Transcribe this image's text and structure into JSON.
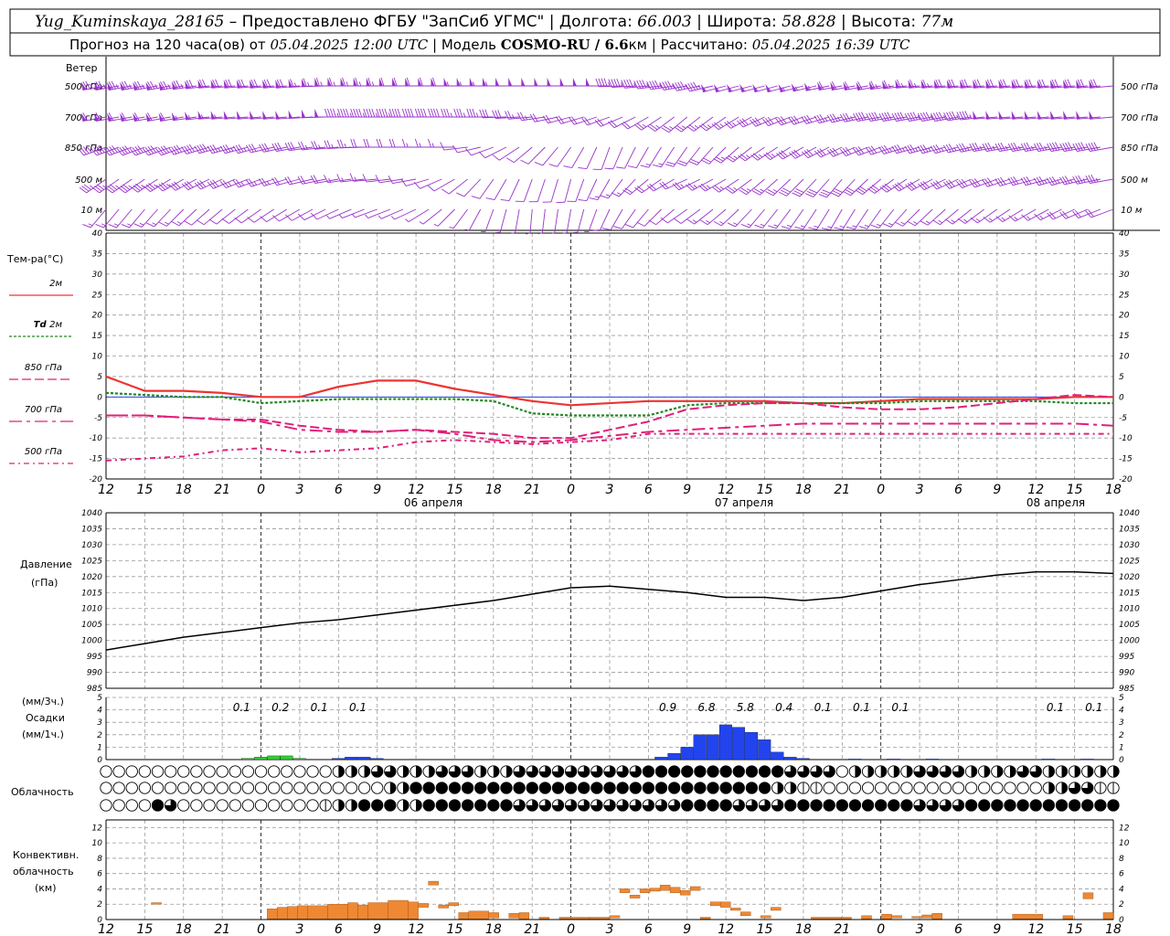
{
  "header": {
    "station": "Yug_Kuminskaya_28165",
    "dash": " – ",
    "provided": "Предоставлено ФГБУ \"ЗапСиб УГМС\"",
    "lon_label": "Долгота:",
    "lon_value": "66.003",
    "lat_label": "Широта:",
    "lat_value": "58.828",
    "alt_label": "Высота:",
    "alt_value": "77м",
    "forecast_label": "Прогноз на 120 часа(ов)  от",
    "forecast_start": "05.04.2025 12:00 UTC",
    "model_label": "Модель",
    "model_name": "COSMO-RU / 6.6",
    "model_unit": "км",
    "calc_label": "Рассчитано:",
    "calc_time": "05.04.2025 16:39 UTC"
  },
  "wind_panel": {
    "title": "Ветер",
    "levels": [
      "500 гПа",
      "700 гПа",
      "850 гПа",
      "500 м",
      "10  м"
    ]
  },
  "temp_panel": {
    "title": "Тем-ра(°C)",
    "legend": [
      {
        "key": "t2m",
        "label": "2м",
        "color": "#ee3333"
      },
      {
        "key": "td2m",
        "label_italic": "Td",
        "label": "2м",
        "color": "#228822"
      },
      {
        "key": "t850",
        "label": "850 гПа",
        "color": "#e0207a"
      },
      {
        "key": "t700",
        "label": "700 гПа",
        "color": "#e0207a"
      },
      {
        "key": "t500",
        "label": "500 гПа",
        "color": "#e0207a"
      }
    ],
    "y_ticks": [
      "40",
      "35",
      "30",
      "25",
      "20",
      "15",
      "10",
      "5",
      "0",
      "-5",
      "-10",
      "-15",
      "-20"
    ]
  },
  "x_axis": {
    "hour_labels": [
      "12",
      "15",
      "18",
      "21",
      "0",
      "3",
      "6",
      "9",
      "12",
      "15",
      "18",
      "21",
      "0",
      "3",
      "6",
      "9",
      "12",
      "15",
      "18",
      "21",
      "0",
      "3",
      "6",
      "9",
      "12",
      "15",
      "18"
    ],
    "day_labels": [
      "06 апреля",
      "07 апреля",
      "08 апреля"
    ]
  },
  "pressure_panel": {
    "title": "Давление",
    "unit": "(гПа)",
    "y_ticks": [
      "1040",
      "1035",
      "1030",
      "1025",
      "1020",
      "1015",
      "1010",
      "1005",
      "1000",
      "995",
      "990",
      "985"
    ]
  },
  "precip_panel": {
    "unit_3h": "(мм/3ч.)",
    "title": "Осадки",
    "unit_1h": "(мм/1ч.)",
    "y_ticks": [
      "5",
      "4",
      "3",
      "2",
      "1",
      "0"
    ],
    "totals": [
      {
        "h": 10.5,
        "v": "0.1"
      },
      {
        "h": 13.5,
        "v": "0.2"
      },
      {
        "h": 16.5,
        "v": "0.1"
      },
      {
        "h": 19.5,
        "v": "0.1"
      },
      {
        "h": 43.5,
        "v": "0.9"
      },
      {
        "h": 46.5,
        "v": "6.8"
      },
      {
        "h": 49.5,
        "v": "5.8"
      },
      {
        "h": 52.5,
        "v": "0.4"
      },
      {
        "h": 55.5,
        "v": "0.1"
      },
      {
        "h": 58.5,
        "v": "0.1"
      },
      {
        "h": 61.5,
        "v": "0.1"
      },
      {
        "h": 73.5,
        "v": "0.1"
      },
      {
        "h": 76.5,
        "v": "0.1"
      }
    ]
  },
  "cloud_panel": {
    "title": "Облачность"
  },
  "conv_panel": {
    "title1": "Конвективн.",
    "title2": "облачность",
    "unit": "(км)",
    "y_ticks": [
      "12",
      "10",
      "8",
      "6",
      "4",
      "2",
      "0"
    ]
  },
  "colors": {
    "wind": "#9933cc",
    "t2m": "#ee3333",
    "td2m": "#228822",
    "tlev": "#e0207a",
    "pressure": "#000000",
    "precip_rain": "#2244ee",
    "precip_mixed": "#33cc33",
    "conv": "#ee8833"
  },
  "chart_data": [
    {
      "type": "line",
      "name": "temperature",
      "ylabel": "Тем-ра(°C)",
      "ylim": [
        -20,
        40
      ],
      "x_hours": [
        0,
        3,
        6,
        9,
        12,
        15,
        18,
        21,
        24,
        27,
        30,
        33,
        36,
        39,
        42,
        45,
        48,
        51,
        54,
        57,
        60,
        63,
        66,
        69,
        72,
        75,
        78
      ],
      "series": [
        {
          "name": "2м",
          "values": [
            5,
            1.5,
            1.5,
            1,
            0,
            0,
            2.5,
            4,
            4,
            2,
            0.5,
            -1,
            -2,
            -1.5,
            -1,
            -1,
            -1,
            -1,
            -1.5,
            -1.5,
            -1,
            -0.5,
            -0.5,
            -0.5,
            -0.5,
            0,
            0
          ]
        },
        {
          "name": "Td 2м",
          "values": [
            1,
            0.5,
            0,
            0,
            -1.5,
            -1,
            -0.5,
            -0.5,
            -0.5,
            -0.5,
            -1,
            -4,
            -4.5,
            -4.5,
            -4.5,
            -2,
            -1.5,
            -1.5,
            -1.5,
            -1.5,
            -1.5,
            -1,
            -1,
            -1,
            -1,
            -1.5,
            -1.5
          ]
        },
        {
          "name": "850 гПа",
          "values": [
            -4.5,
            -4.5,
            -5,
            -5.5,
            -5.5,
            -7,
            -8,
            -8.5,
            -8,
            -8.5,
            -9,
            -10,
            -10,
            -8,
            -6,
            -3,
            -2,
            -1.5,
            -1.5,
            -2.5,
            -3,
            -3,
            -2.5,
            -1.5,
            -0.5,
            0.5,
            0
          ]
        },
        {
          "name": "700 гПа",
          "values": [
            -4.5,
            -4.5,
            -5,
            -5.5,
            -6,
            -8,
            -8.5,
            -8.5,
            -8,
            -9,
            -10.5,
            -11,
            -10.5,
            -9.5,
            -8.5,
            -8,
            -7.5,
            -7,
            -6.5,
            -6.5,
            -6.5,
            -6.5,
            -6.5,
            -6.5,
            -6.5,
            -6.5,
            -7
          ]
        },
        {
          "name": "500 гПа",
          "values": [
            -15.5,
            -15,
            -14.5,
            -13,
            -12.5,
            -13.5,
            -13,
            -12.5,
            -11,
            -10.5,
            -11,
            -11.5,
            -11,
            -10.5,
            -9,
            -9,
            -9,
            -9,
            -9,
            -9,
            -9,
            -9,
            -9,
            -9,
            -9,
            -9,
            -9
          ]
        }
      ]
    },
    {
      "type": "line",
      "name": "pressure",
      "ylabel": "Давление (гПа)",
      "ylim": [
        985,
        1040
      ],
      "x_hours": [
        0,
        3,
        6,
        9,
        12,
        15,
        18,
        21,
        24,
        27,
        30,
        33,
        36,
        39,
        42,
        45,
        48,
        51,
        54,
        57,
        60,
        63,
        66,
        69,
        72,
        75,
        78
      ],
      "values": [
        997,
        999,
        1001,
        1002.5,
        1004,
        1005.5,
        1006.5,
        1008,
        1009.5,
        1011,
        1012.5,
        1014.5,
        1016.5,
        1017,
        1016,
        1015,
        1013.5,
        1013.5,
        1012.5,
        1013.5,
        1015.5,
        1017.5,
        1019,
        1020.5,
        1021.5,
        1021.5,
        1021
      ]
    },
    {
      "type": "bar",
      "name": "precipitation",
      "ylabel": "Осадки (мм/1ч.)",
      "ylim": [
        0,
        5
      ],
      "x_hours": [
        11,
        12,
        13,
        14,
        15,
        18,
        19,
        20,
        21,
        43,
        44,
        45,
        46,
        47,
        48,
        49,
        50,
        51,
        52,
        53,
        54,
        58,
        61,
        64,
        73,
        76
      ],
      "values": [
        0.1,
        0.2,
        0.3,
        0.3,
        0.1,
        0.1,
        0.2,
        0.2,
        0.1,
        0.2,
        0.5,
        1,
        2,
        2,
        2.8,
        2.6,
        2.2,
        1.6,
        0.6,
        0.2,
        0.1,
        0.05,
        0.05,
        0.05,
        0.05,
        0.05
      ],
      "colors": [
        "mixed",
        "mixed",
        "mixed",
        "mixed",
        "mixed",
        "rain",
        "rain",
        "rain",
        "rain",
        "rain",
        "rain",
        "rain",
        "rain",
        "rain",
        "rain",
        "rain",
        "rain",
        "rain",
        "rain",
        "rain",
        "rain",
        "rain",
        "rain",
        "rain",
        "rain",
        "rain"
      ]
    },
    {
      "type": "bar",
      "name": "convective_clouds",
      "ylabel": "Конвективн. облачность (км)",
      "ylim": [
        0,
        13
      ],
      "segments": [
        {
          "x0": 4.5,
          "x1": 5.5,
          "y0": 2,
          "y1": 2.2
        },
        {
          "x0": 16,
          "x1": 17,
          "y0": 0.1,
          "y1": 1.4
        },
        {
          "x0": 17,
          "x1": 18,
          "y0": 0.1,
          "y1": 1.6
        },
        {
          "x0": 18,
          "x1": 19,
          "y0": 0.1,
          "y1": 1.7
        },
        {
          "x0": 19,
          "x1": 20,
          "y0": 0.1,
          "y1": 1.8
        },
        {
          "x0": 20,
          "x1": 22,
          "y0": 0.1,
          "y1": 1.8
        },
        {
          "x0": 22,
          "x1": 24,
          "y0": 0.1,
          "y1": 2
        },
        {
          "x0": 24,
          "x1": 25,
          "y0": 0.1,
          "y1": 2.2
        },
        {
          "x0": 25,
          "x1": 26,
          "y0": 0.1,
          "y1": 1.9
        },
        {
          "x0": 26,
          "x1": 28,
          "y0": 0.1,
          "y1": 2.2
        },
        {
          "x0": 28,
          "x1": 30,
          "y0": 0.1,
          "y1": 2.5
        },
        {
          "x0": 30,
          "x1": 31,
          "y0": 0.1,
          "y1": 2.3
        },
        {
          "x0": 31,
          "x1": 32,
          "y0": 1.6,
          "y1": 2.1
        },
        {
          "x0": 32,
          "x1": 33,
          "y0": 4.5,
          "y1": 5
        },
        {
          "x0": 33,
          "x1": 34,
          "y0": 1.5,
          "y1": 1.9
        },
        {
          "x0": 34,
          "x1": 35,
          "y0": 1.8,
          "y1": 2.2
        },
        {
          "x0": 35,
          "x1": 36,
          "y0": 0.1,
          "y1": 0.9
        },
        {
          "x0": 36,
          "x1": 38,
          "y0": 0.1,
          "y1": 1.1
        },
        {
          "x0": 38,
          "x1": 39,
          "y0": 0.2,
          "y1": 0.9
        },
        {
          "x0": 40,
          "x1": 41,
          "y0": 0.2,
          "y1": 0.8
        },
        {
          "x0": 41,
          "x1": 42,
          "y0": 0.1,
          "y1": 0.9
        },
        {
          "x0": 43,
          "x1": 44,
          "y0": 0.1,
          "y1": 0.3
        },
        {
          "x0": 45,
          "x1": 48,
          "y0": 0.1,
          "y1": 0.3
        },
        {
          "x0": 48,
          "x1": 50,
          "y0": 0.1,
          "y1": 0.3
        },
        {
          "x0": 50,
          "x1": 51,
          "y0": 0.2,
          "y1": 0.5
        },
        {
          "x0": 51,
          "x1": 52,
          "y0": 3.5,
          "y1": 4
        },
        {
          "x0": 52,
          "x1": 53,
          "y0": 2.8,
          "y1": 3.2
        },
        {
          "x0": 53,
          "x1": 54,
          "y0": 3.5,
          "y1": 4
        },
        {
          "x0": 54,
          "x1": 55,
          "y0": 3.7,
          "y1": 4.1
        },
        {
          "x0": 55,
          "x1": 56,
          "y0": 3.8,
          "y1": 4.5
        },
        {
          "x0": 56,
          "x1": 57,
          "y0": 3.5,
          "y1": 4.2
        },
        {
          "x0": 57,
          "x1": 58,
          "y0": 3.2,
          "y1": 3.8
        },
        {
          "x0": 58,
          "x1": 59,
          "y0": 3.8,
          "y1": 4.3
        },
        {
          "x0": 59,
          "x1": 60,
          "y0": 0.1,
          "y1": 0.3
        },
        {
          "x0": 60,
          "x1": 61,
          "y0": 1.8,
          "y1": 2.3
        },
        {
          "x0": 61,
          "x1": 62,
          "y0": 1.6,
          "y1": 2.3
        },
        {
          "x0": 62,
          "x1": 63,
          "y0": 1.2,
          "y1": 1.5
        },
        {
          "x0": 63,
          "x1": 64,
          "y0": 0.5,
          "y1": 1
        },
        {
          "x0": 65,
          "x1": 66,
          "y0": 0.2,
          "y1": 0.5
        },
        {
          "x0": 66,
          "x1": 67,
          "y0": 1.2,
          "y1": 1.6
        },
        {
          "x0": 70,
          "x1": 73,
          "y0": 0.1,
          "y1": 0.3
        },
        {
          "x0": 73,
          "x1": 74,
          "y0": 0.1,
          "y1": 0.3
        },
        {
          "x0": 75,
          "x1": 76,
          "y0": 0.1,
          "y1": 0.5
        },
        {
          "x0": 77,
          "x1": 78,
          "y0": 0.1,
          "y1": 0.7
        },
        {
          "x0": 78,
          "x1": 79,
          "y0": 0.2,
          "y1": 0.5
        },
        {
          "x0": 80,
          "x1": 81,
          "y0": 0.2,
          "y1": 0.4
        },
        {
          "x0": 81,
          "x1": 82,
          "y0": 0.2,
          "y1": 0.6
        },
        {
          "x0": 82,
          "x1": 83,
          "y0": 0.1,
          "y1": 0.8
        },
        {
          "x0": 90,
          "x1": 93,
          "y0": 0.1,
          "y1": 0.7
        },
        {
          "x0": 95,
          "x1": 96,
          "y0": 0.1,
          "y1": 0.5
        },
        {
          "x0": 97,
          "x1": 98,
          "y0": 2.7,
          "y1": 3.5
        },
        {
          "x0": 99,
          "x1": 100,
          "y0": 0.1,
          "y1": 0.9
        }
      ]
    }
  ]
}
